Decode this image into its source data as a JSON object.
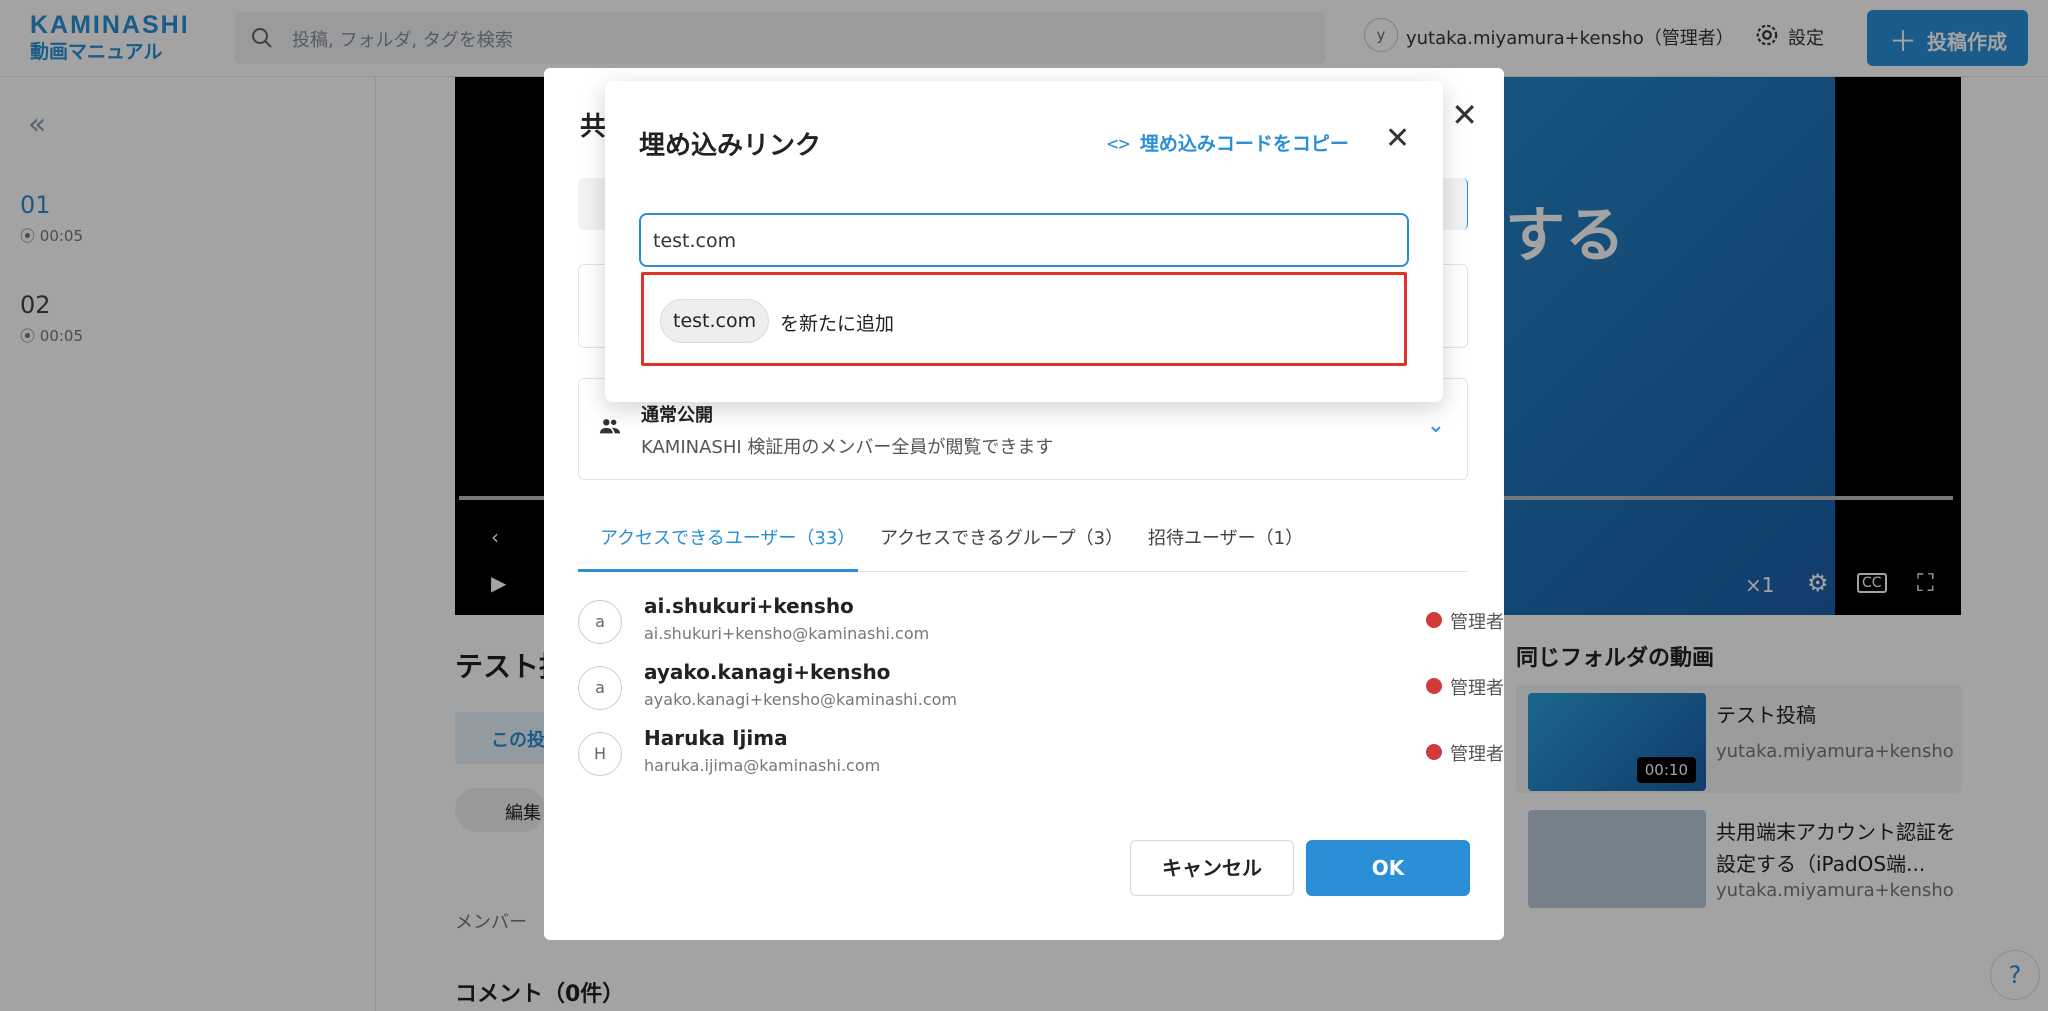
{
  "header": {
    "logo_line1": "KAMINASHI",
    "logo_line2": "動画マニュアル",
    "search_placeholder": "投稿, フォルダ, タグを検索",
    "user_avatar": "y",
    "user_name": "yutaka.miyamura+kensho（管理者）",
    "settings_label": "設定",
    "create_label": "投稿作成"
  },
  "sidebar": {
    "chapters": [
      {
        "num": "01",
        "duration": "00:05"
      },
      {
        "num": "02",
        "duration": "00:05"
      }
    ]
  },
  "main": {
    "title_partial": "テスト投",
    "post_chip": "この投稿",
    "edit_label": "編集",
    "member_label": "メンバー",
    "comment_head": "コメント（0件）",
    "video_text": "する",
    "rate": "×1"
  },
  "related": {
    "heading": "同じフォルダの動画",
    "items": [
      {
        "title": "テスト投稿",
        "author": "yutaka.miyamura+kensho",
        "duration": "00:10"
      },
      {
        "title": "共用端末アカウント認証を設定する（iPadOS端...",
        "author": "yutaka.miyamura+kensho"
      }
    ]
  },
  "share_modal": {
    "title": "共",
    "visibility_title": "通常公開",
    "visibility_desc": "KAMINASHI 検証用のメンバー全員が閲覧できます",
    "tabs": [
      "アクセスできるユーザー（33）",
      "アクセスできるグループ（3）",
      "招待ユーザー（1）"
    ],
    "users": [
      {
        "avatar": "a",
        "name": "ai.shukuri+kensho",
        "email": "ai.shukuri+kensho@kaminashi.com",
        "role": "管理者"
      },
      {
        "avatar": "a",
        "name": "ayako.kanagi+kensho",
        "email": "ayako.kanagi+kensho@kaminashi.com",
        "role": "管理者"
      },
      {
        "avatar": "H",
        "name": "Haruka Ijima",
        "email": "haruka.ijima@kaminashi.com",
        "role": "管理者"
      }
    ],
    "cancel_label": "キャンセル",
    "ok_label": "OK"
  },
  "embed_modal": {
    "title": "埋め込みリンク",
    "copy_label": "埋め込みコードをコピー",
    "input_value": "test.com",
    "suggestion_chip": "test.com",
    "suggestion_text": "を新たに追加"
  },
  "colors": {
    "accent": "#2a8fd6",
    "highlight": "#e0322c",
    "admin_dot": "#d23b3b"
  }
}
